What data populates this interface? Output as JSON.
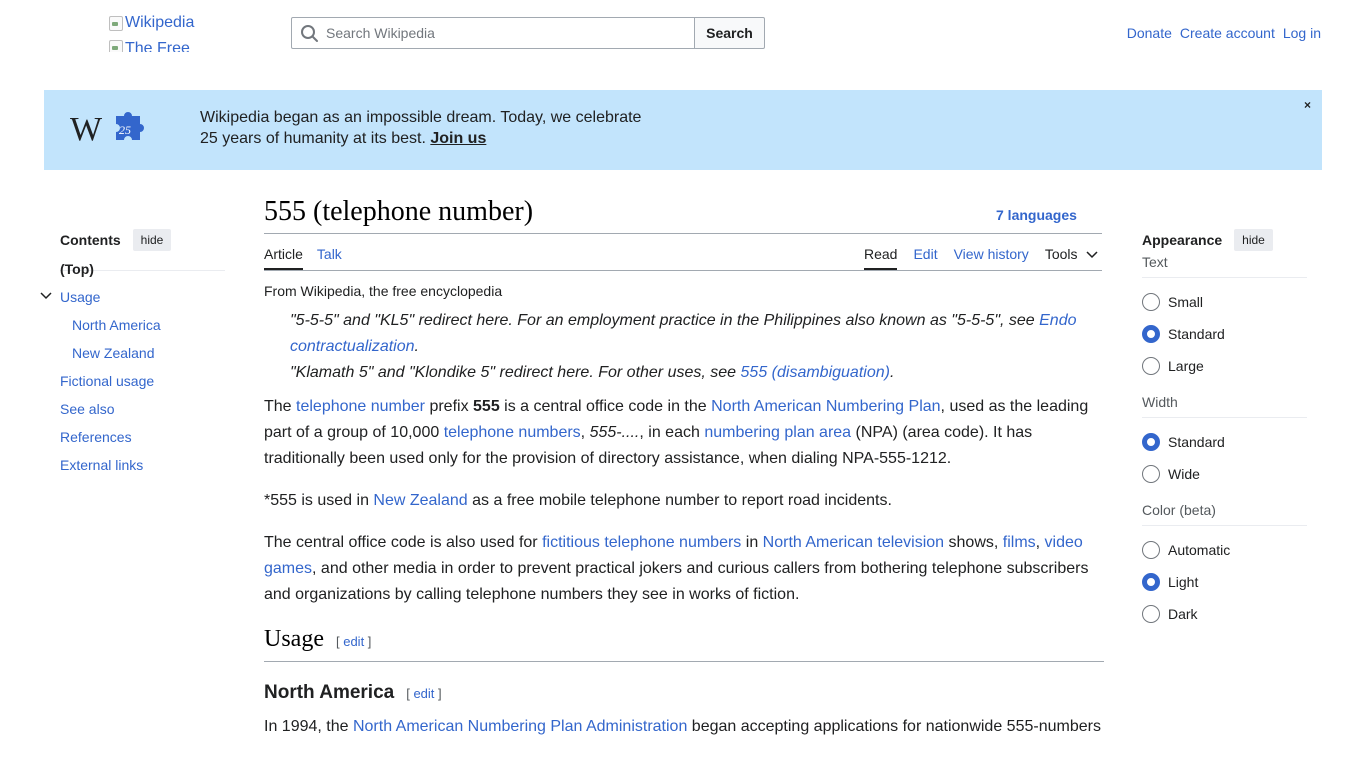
{
  "header": {
    "logo_alt_1": "Wikipedia",
    "logo_alt_2": "The Free",
    "search_placeholder": "Search Wikipedia",
    "search_button": "Search",
    "links": [
      "Donate",
      "Create account",
      "Log in"
    ]
  },
  "banner": {
    "line1": "Wikipedia began as an impossible dream. Today, we celebrate",
    "line2": "25 years of humanity at its best.",
    "join": "Join us",
    "close": "×",
    "logo_letter": "W",
    "logo_number": "25",
    "bg_color": "#c2e4fc"
  },
  "toc": {
    "title": "Contents",
    "hide": "hide",
    "items": [
      {
        "label": "(Top)"
      },
      {
        "label": "Usage"
      },
      {
        "label": "North America"
      },
      {
        "label": "New Zealand"
      },
      {
        "label": "Fictional usage"
      },
      {
        "label": "See also"
      },
      {
        "label": "References"
      },
      {
        "label": "External links"
      }
    ]
  },
  "article": {
    "title": "555 (telephone number)",
    "languages": "7 languages",
    "tabs_left": [
      "Article",
      "Talk"
    ],
    "tabs_right": [
      "Read",
      "Edit",
      "View history",
      "Tools"
    ],
    "from": "From Wikipedia, the free encyclopedia",
    "hatnote1_text": "\"5-5-5\" and \"KL5\" redirect here. For an employment practice in the Philippines also known as \"5-5-5\", see ",
    "hatnote1_link": "Endo contractualization",
    "hatnote2_text": "\"Klamath 5\" and \"Klondike 5\" redirect here. For other uses, see ",
    "hatnote2_link": "555 (disambiguation)",
    "p1": {
      "t1": "The ",
      "l1": "telephone number",
      "t2": " prefix ",
      "b1": "555",
      "t3": " is a central office code in the ",
      "l2": "North American Numbering Plan",
      "t4": ", used as the leading part of a group of 10,000 ",
      "l3": "telephone numbers",
      "t5": ", ",
      "i1": "555-....",
      "t6": ", in each ",
      "l4": "numbering plan area",
      "t7": " (NPA) (area code). It has traditionally been used only for the provision of directory assistance, when dialing NPA-555-1212."
    },
    "p2": {
      "t1": "*555 is used in ",
      "l1": "New Zealand",
      "t2": " as a free mobile telephone number to report road incidents."
    },
    "p3": {
      "t1": "The central office code is also used for ",
      "l1": "fictitious telephone numbers",
      "t2": " in ",
      "l2": "North American television",
      "t3": " shows, ",
      "l3": "films",
      "t4": ", ",
      "l4": "video games",
      "t5": ", and other media in order to prevent practical jokers and curious callers from bothering telephone subscribers and organizations by calling telephone numbers they see in works of fiction."
    },
    "h2_usage": "Usage",
    "h3_na": "North America",
    "edit_label": "edit",
    "p4": {
      "t1": "In 1994, the ",
      "l1": "North American Numbering Plan Administration",
      "t2": " began accepting applications for nationwide 555-numbers"
    }
  },
  "appearance": {
    "title": "Appearance",
    "hide": "hide",
    "groups": [
      {
        "label": "Text",
        "options": [
          "Small",
          "Standard",
          "Large"
        ],
        "selected": 1
      },
      {
        "label": "Width",
        "options": [
          "Standard",
          "Wide"
        ],
        "selected": 0
      },
      {
        "label": "Color (beta)",
        "options": [
          "Automatic",
          "Light",
          "Dark"
        ],
        "selected": 1
      }
    ],
    "accent_color": "#3366cc"
  }
}
